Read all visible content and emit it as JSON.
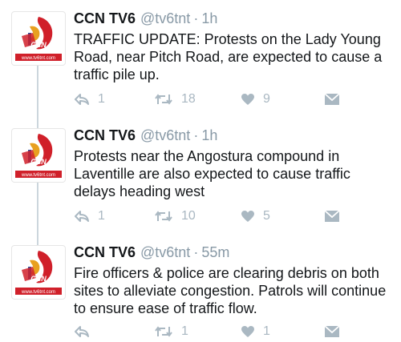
{
  "tweets": [
    {
      "name": "CCN TV6",
      "handle": "@tv6tnt",
      "separator": "·",
      "time": "1h",
      "text": "TRAFFIC UPDATE: Protests on the Lady Young Road, near Pitch Road, are expected to cause a traffic pile up.",
      "reply_count": "1",
      "retweet_count": "18",
      "like_count": "9"
    },
    {
      "name": "CCN TV6",
      "handle": "@tv6tnt",
      "separator": "·",
      "time": "1h",
      "text": "Protests near the Angostura compound in Laventille are also expected to cause traffic delays heading west",
      "reply_count": "1",
      "retweet_count": "10",
      "like_count": "5"
    },
    {
      "name": "CCN TV6",
      "handle": "@tv6tnt",
      "separator": "·",
      "time": "55m",
      "text": "Fire officers & police are clearing debris on both sites to alleviate congestion. Patrols will continue to ensure ease of traffic flow.",
      "reply_count": "",
      "retweet_count": "1",
      "like_count": "1"
    }
  ],
  "avatar": {
    "logo_text": "CCN",
    "url_text": "www.tv6tnt.com",
    "brand_color": "#d0202a"
  },
  "icons": {
    "reply": "reply-icon",
    "retweet": "retweet-icon",
    "like": "heart-icon",
    "message": "direct-message-icon"
  },
  "colors": {
    "text": "#14171a",
    "muted": "#8899a6",
    "action": "#aab8c2",
    "thread": "#ccd6dd"
  }
}
